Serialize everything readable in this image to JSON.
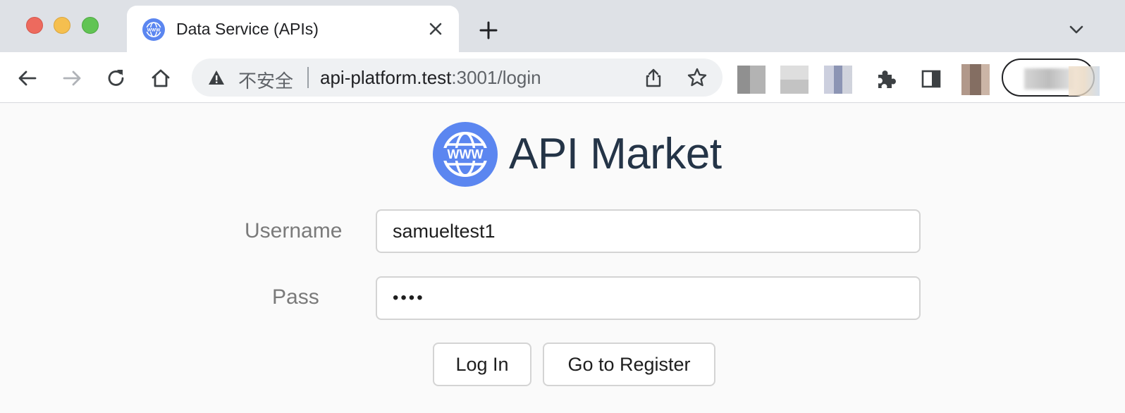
{
  "browser": {
    "tab": {
      "title": "Data Service (APIs)",
      "favicon": "globe-www-icon"
    },
    "omnibox": {
      "security_label": "不安全",
      "url_host": "api-platform.test",
      "url_path": ":3001/login"
    },
    "icons": {
      "back": "back-arrow-icon",
      "forward": "forward-arrow-icon",
      "reload": "reload-icon",
      "home": "home-icon",
      "share": "share-icon",
      "bookmark": "star-icon",
      "extensions": "puzzle-icon",
      "side_panel": "side-panel-icon",
      "new_tab": "plus-icon",
      "tab_search": "chevron-down-icon"
    }
  },
  "page": {
    "brand_title": "API Market",
    "brand_color": "#5b86f0",
    "form": {
      "username_label": "Username",
      "username_value": "samueltest1",
      "pass_label": "Pass",
      "pass_value": "••••",
      "login_button": "Log In",
      "register_button": "Go to Register"
    }
  }
}
